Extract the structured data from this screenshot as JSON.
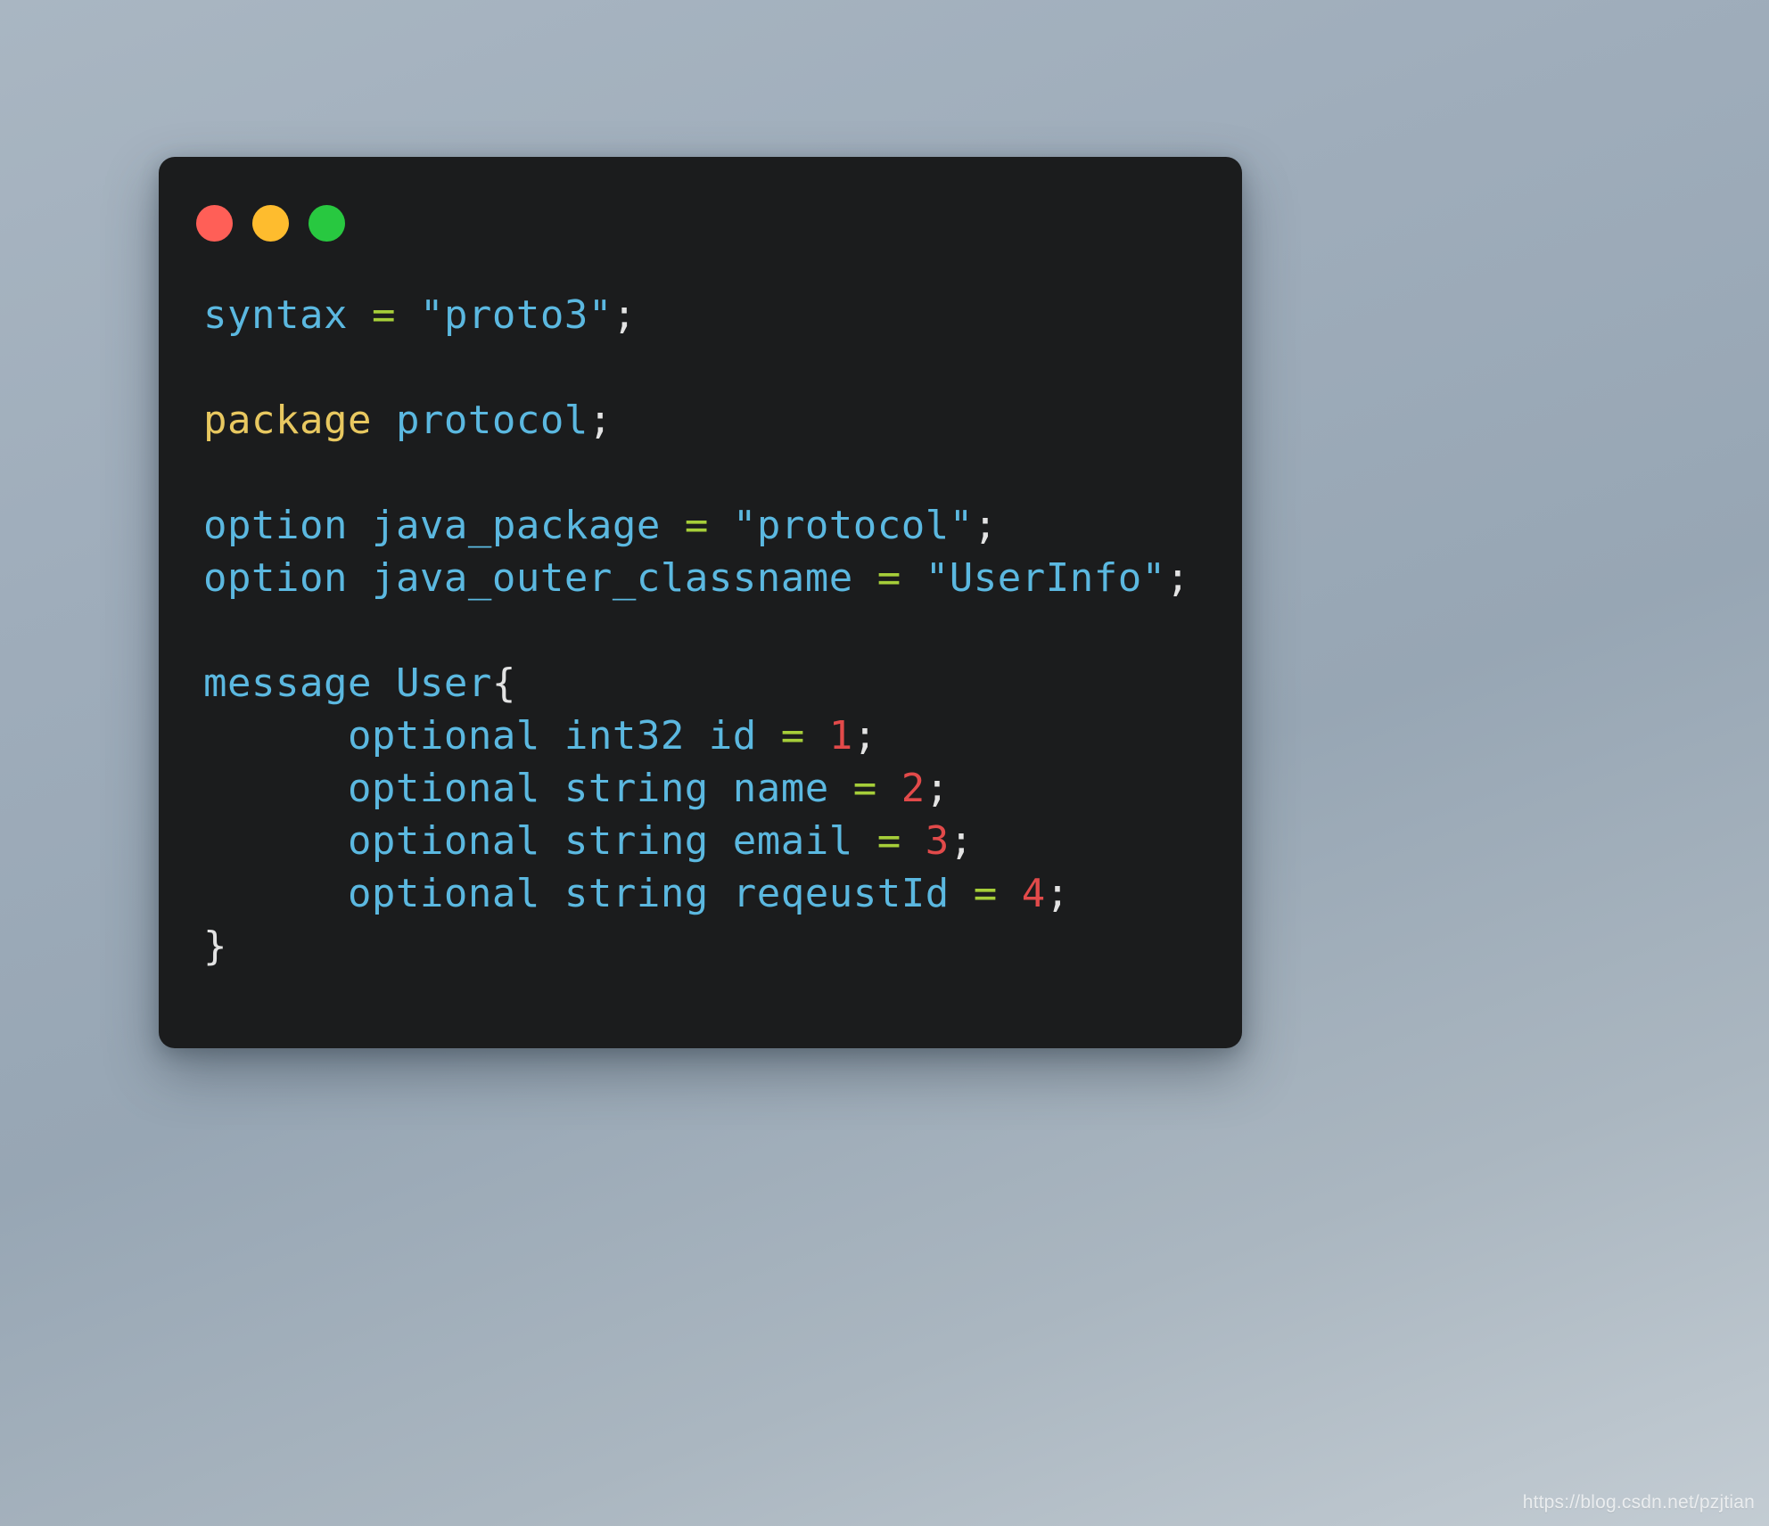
{
  "window": {
    "traffic_lights": [
      {
        "name": "close",
        "color": "#ff5f57"
      },
      {
        "name": "minimize",
        "color": "#febc2e"
      },
      {
        "name": "maximize",
        "color": "#28c840"
      }
    ]
  },
  "code": {
    "language": "protobuf",
    "lines": [
      {
        "id": 1,
        "tokens": [
          {
            "t": "syntax",
            "c": "kw"
          },
          {
            "t": " ",
            "c": "plain"
          },
          {
            "t": "=",
            "c": "op"
          },
          {
            "t": " ",
            "c": "plain"
          },
          {
            "t": "\"proto3\"",
            "c": "str"
          },
          {
            "t": ";",
            "c": "punc"
          }
        ]
      },
      {
        "id": 2,
        "tokens": []
      },
      {
        "id": 3,
        "tokens": [
          {
            "t": "package",
            "c": "pkg"
          },
          {
            "t": " ",
            "c": "plain"
          },
          {
            "t": "protocol",
            "c": "kw"
          },
          {
            "t": ";",
            "c": "punc"
          }
        ]
      },
      {
        "id": 4,
        "tokens": []
      },
      {
        "id": 5,
        "tokens": [
          {
            "t": "option",
            "c": "kw"
          },
          {
            "t": " ",
            "c": "plain"
          },
          {
            "t": "java_package",
            "c": "kw"
          },
          {
            "t": " ",
            "c": "plain"
          },
          {
            "t": "=",
            "c": "op"
          },
          {
            "t": " ",
            "c": "plain"
          },
          {
            "t": "\"protocol\"",
            "c": "str"
          },
          {
            "t": ";",
            "c": "punc"
          }
        ]
      },
      {
        "id": 6,
        "tokens": [
          {
            "t": "option",
            "c": "kw"
          },
          {
            "t": " ",
            "c": "plain"
          },
          {
            "t": "java_outer_classname",
            "c": "kw"
          },
          {
            "t": " ",
            "c": "plain"
          },
          {
            "t": "=",
            "c": "op"
          },
          {
            "t": " ",
            "c": "plain"
          },
          {
            "t": "\"UserInfo\"",
            "c": "str"
          },
          {
            "t": ";",
            "c": "punc"
          }
        ]
      },
      {
        "id": 7,
        "tokens": []
      },
      {
        "id": 8,
        "tokens": [
          {
            "t": "message",
            "c": "kw"
          },
          {
            "t": " ",
            "c": "plain"
          },
          {
            "t": "User",
            "c": "kw"
          },
          {
            "t": "{",
            "c": "punc"
          }
        ]
      },
      {
        "id": 9,
        "tokens": [
          {
            "t": "      optional int32 id ",
            "c": "kw"
          },
          {
            "t": "=",
            "c": "op"
          },
          {
            "t": " ",
            "c": "plain"
          },
          {
            "t": "1",
            "c": "num"
          },
          {
            "t": ";",
            "c": "punc"
          }
        ]
      },
      {
        "id": 10,
        "tokens": [
          {
            "t": "      optional string name ",
            "c": "kw"
          },
          {
            "t": "=",
            "c": "op"
          },
          {
            "t": " ",
            "c": "plain"
          },
          {
            "t": "2",
            "c": "num"
          },
          {
            "t": ";",
            "c": "punc"
          }
        ]
      },
      {
        "id": 11,
        "tokens": [
          {
            "t": "      optional string email ",
            "c": "kw"
          },
          {
            "t": "=",
            "c": "op"
          },
          {
            "t": " ",
            "c": "plain"
          },
          {
            "t": "3",
            "c": "num"
          },
          {
            "t": ";",
            "c": "punc"
          }
        ]
      },
      {
        "id": 12,
        "tokens": [
          {
            "t": "      optional string reqeustId ",
            "c": "kw"
          },
          {
            "t": "=",
            "c": "op"
          },
          {
            "t": " ",
            "c": "plain"
          },
          {
            "t": "4",
            "c": "num"
          },
          {
            "t": ";",
            "c": "punc"
          }
        ]
      },
      {
        "id": 13,
        "tokens": [
          {
            "t": "}",
            "c": "punc"
          }
        ]
      }
    ],
    "plain_text": "syntax = \"proto3\";\n\npackage protocol;\n\noption java_package = \"protocol\";\noption java_outer_classname = \"UserInfo\";\n\nmessage User{\n      optional int32 id = 1;\n      optional string name = 2;\n      optional string email = 3;\n      optional string reqeustId = 4;\n}"
  },
  "watermark": {
    "text": "https://blog.csdn.net/pzjtian"
  },
  "theme": {
    "window_background": "#1b1c1d",
    "page_background": "#9fadbb",
    "keyword": "#5bb8e0",
    "package_keyword": "#e8c860",
    "string": "#5bb8e0",
    "operator": "#a6ce39",
    "punctuation": "#e3e3e3",
    "number": "#e24a4a"
  }
}
